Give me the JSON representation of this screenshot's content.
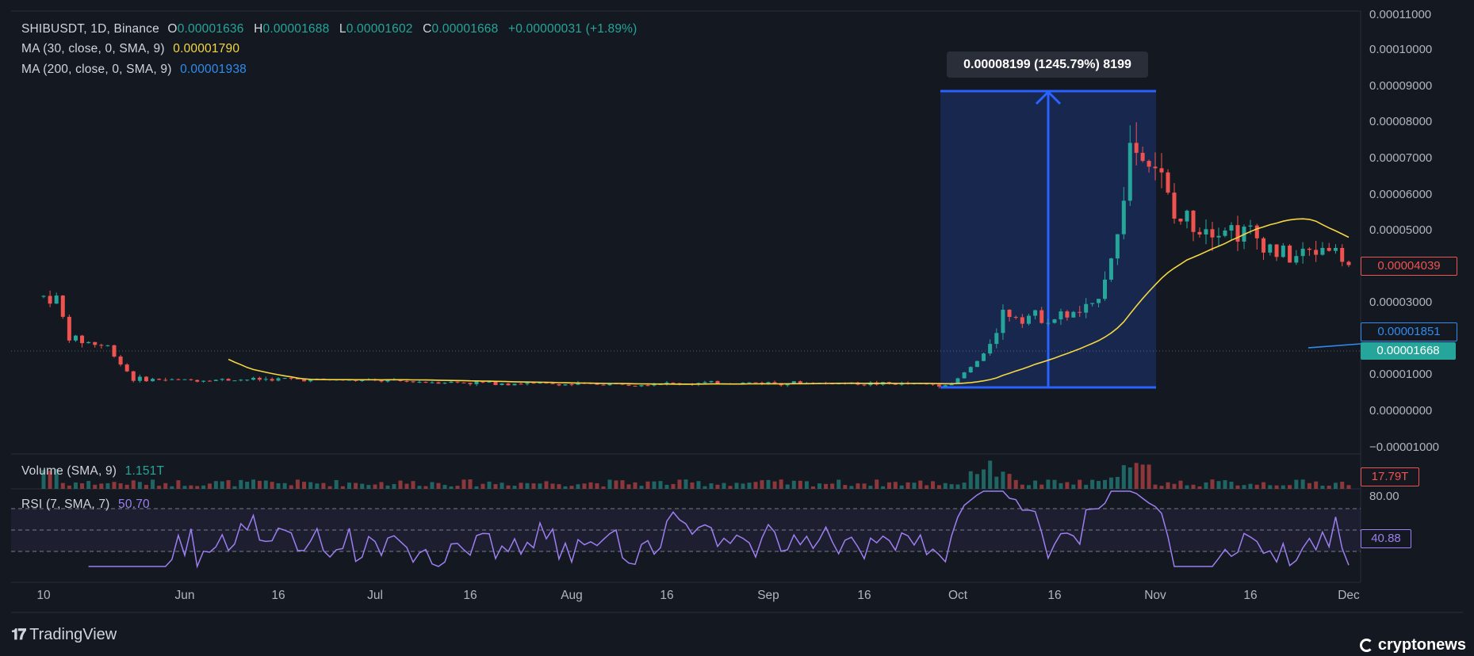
{
  "legend": {
    "symbol": "SHIBUSDT, 1D, Binance",
    "open_label": "O",
    "open": "0.00001636",
    "high_label": "H",
    "high": "0.00001688",
    "low_label": "L",
    "low": "0.00001602",
    "close_label": "C",
    "close": "0.00001668",
    "change": "+0.00000031 (+1.89%)",
    "ma30_label": "MA (30, close, 0, SMA, 9)",
    "ma30_value": "0.00001790",
    "ma200_label": "MA (200, close, 0, SMA, 9)",
    "ma200_value": "0.00001938"
  },
  "measure_label": "0.00008199 (1245.79%) 8199",
  "price_axis": [
    "0.00011000",
    "0.00010000",
    "0.00009000",
    "0.00008000",
    "0.00007000",
    "0.00006000",
    "0.00005000",
    "0.00003000",
    "0.00001000",
    "0.00000000",
    "−0.00001000"
  ],
  "price_labels": {
    "last_red": "0.00004039",
    "ma200": "0.00001851",
    "last_close": "0.00001668",
    "volume": "17.79T",
    "rsi": "40.88",
    "rsi_level": "80.00"
  },
  "volume_legend": {
    "label": "Volume (SMA, 9)",
    "value": "1.151T"
  },
  "rsi_legend": {
    "label": "RSI (7, SMA, 7)",
    "value": "50.70"
  },
  "time_axis": [
    "10",
    "Jun",
    "16",
    "Jul",
    "16",
    "Aug",
    "16",
    "Sep",
    "16",
    "Oct",
    "16",
    "Nov",
    "16",
    "Dec"
  ],
  "brand": "TradingView",
  "watermark": "cryptonews",
  "colors": {
    "up": "#26a69a",
    "down": "#ef5350",
    "ma30": "#f5d742",
    "ma200": "#2f8cf0",
    "rsi": "#9c7ff0",
    "measure": "#2962ff"
  },
  "chart_data": {
    "type": "candlestick",
    "symbol": "SHIBUSDT",
    "interval": "1D",
    "ylim": [
      -1e-05,
      0.00011
    ],
    "series": [
      {
        "name": "MA (30, close, 0, SMA, 9)",
        "last": 1.79e-05
      },
      {
        "name": "MA (200, close, 0, SMA, 9)",
        "last": 1.938e-05
      }
    ],
    "measure": {
      "change": 8.199e-05,
      "percent": 1245.79,
      "ticks": 8199
    },
    "close_points": [
      {
        "x": "May 10",
        "y": 3.15e-05
      },
      {
        "x": "May 12",
        "y": 3.1e-05
      },
      {
        "x": "May 14",
        "y": 2e-05
      },
      {
        "x": "May 20",
        "y": 1.75e-05
      },
      {
        "x": "May 24",
        "y": 8.5e-06
      },
      {
        "x": "Jun 1",
        "y": 8.2e-06
      },
      {
        "x": "Jun 16",
        "y": 8.5e-06
      },
      {
        "x": "Jul 1",
        "y": 8e-06
      },
      {
        "x": "Aug 1",
        "y": 7e-06
      },
      {
        "x": "Sep 1",
        "y": 7.5e-06
      },
      {
        "x": "Sep 30",
        "y": 7e-06
      },
      {
        "x": "Oct 5",
        "y": 1.5e-05
      },
      {
        "x": "Oct 8",
        "y": 2.7e-05
      },
      {
        "x": "Oct 16",
        "y": 2.55e-05
      },
      {
        "x": "Oct 22",
        "y": 2.8e-05
      },
      {
        "x": "Oct 26",
        "y": 4.8e-05
      },
      {
        "x": "Oct 28",
        "y": 7.4e-05
      },
      {
        "x": "Nov 1",
        "y": 6.9e-05
      },
      {
        "x": "Nov 4",
        "y": 5.3e-05
      },
      {
        "x": "Nov 10",
        "y": 5.2e-05
      },
      {
        "x": "Nov 16",
        "y": 4.9e-05
      },
      {
        "x": "Nov 22",
        "y": 4.2e-05
      },
      {
        "x": "Nov 28",
        "y": 4.6e-05
      },
      {
        "x": "Dec 1",
        "y": 4.04e-05
      }
    ]
  }
}
